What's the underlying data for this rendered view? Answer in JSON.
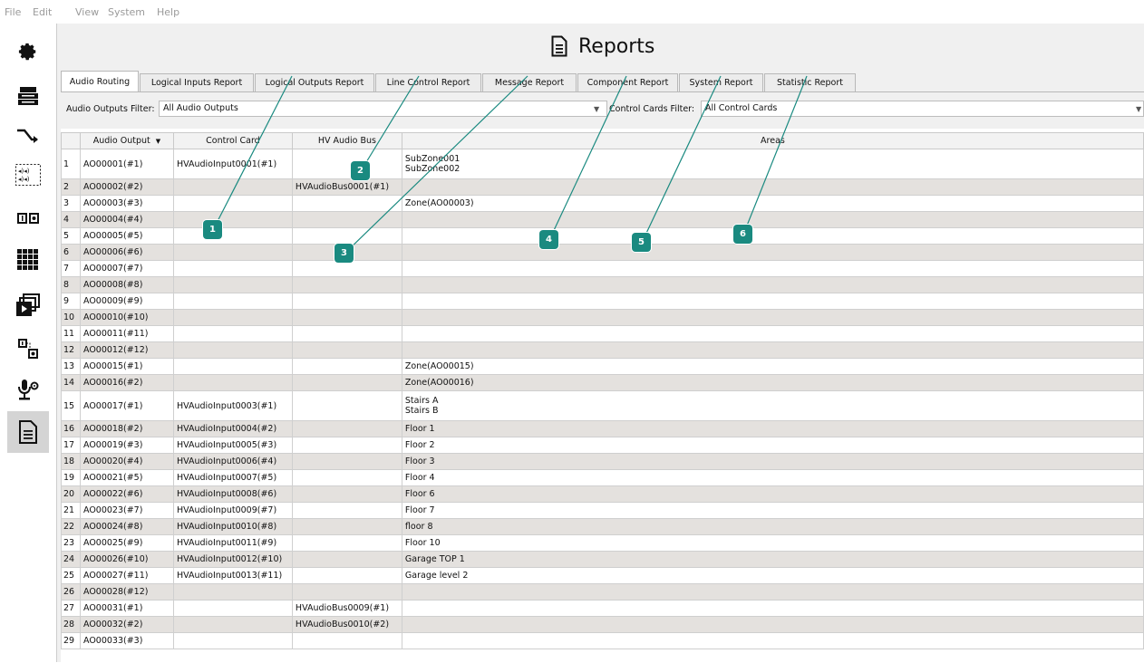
{
  "menu": [
    "File",
    "Edit",
    "View",
    "System",
    "Help"
  ],
  "sidebar": {
    "items": [
      {
        "icon": "gear-icon"
      },
      {
        "icon": "server-icon"
      },
      {
        "icon": "routing-arrow-icon"
      },
      {
        "icon": "speakers-icon"
      },
      {
        "icon": "io-modules-icon"
      },
      {
        "icon": "grid-icon"
      },
      {
        "icon": "media-player-icon"
      },
      {
        "icon": "connection-icon"
      },
      {
        "icon": "microphone-settings-icon"
      },
      {
        "icon": "document-icon",
        "active": true
      }
    ]
  },
  "header": {
    "title": "Reports",
    "icon": "document-icon"
  },
  "tabs": [
    {
      "label": "Audio Routing",
      "active": true
    },
    {
      "label": "Logical Inputs Report"
    },
    {
      "label": "Logical Outputs Report"
    },
    {
      "label": "Line Control Report"
    },
    {
      "label": "Message Report"
    },
    {
      "label": "Component Report"
    },
    {
      "label": "System Report"
    },
    {
      "label": "Statistic Report"
    }
  ],
  "filters": {
    "audio_outputs_label": "Audio Outputs Filter:",
    "audio_outputs_value": "All Audio Outputs",
    "control_cards_label": "Control Cards Filter:",
    "control_cards_value": "All Control Cards"
  },
  "table": {
    "columns": [
      "Audio Output",
      "Control Card",
      "HV Audio Bus",
      "Areas"
    ],
    "sort_indicator": "▼",
    "rows": [
      {
        "n": "1",
        "output": "AO00001(#1)",
        "card": "HVAudioInput0001(#1)",
        "bus": "",
        "areas": [
          "SubZone001",
          "SubZone002"
        ]
      },
      {
        "n": "2",
        "output": "AO00002(#2)",
        "card": "",
        "bus": "HVAudioBus0001(#1)",
        "areas": []
      },
      {
        "n": "3",
        "output": "AO00003(#3)",
        "card": "",
        "bus": "",
        "areas": [
          "Zone(AO00003)"
        ]
      },
      {
        "n": "4",
        "output": "AO00004(#4)",
        "card": "",
        "bus": "",
        "areas": []
      },
      {
        "n": "5",
        "output": "AO00005(#5)",
        "card": "",
        "bus": "",
        "areas": []
      },
      {
        "n": "6",
        "output": "AO00006(#6)",
        "card": "",
        "bus": "",
        "areas": []
      },
      {
        "n": "7",
        "output": "AO00007(#7)",
        "card": "",
        "bus": "",
        "areas": []
      },
      {
        "n": "8",
        "output": "AO00008(#8)",
        "card": "",
        "bus": "",
        "areas": []
      },
      {
        "n": "9",
        "output": "AO00009(#9)",
        "card": "",
        "bus": "",
        "areas": []
      },
      {
        "n": "10",
        "output": "AO00010(#10)",
        "card": "",
        "bus": "",
        "areas": []
      },
      {
        "n": "11",
        "output": "AO00011(#11)",
        "card": "",
        "bus": "",
        "areas": []
      },
      {
        "n": "12",
        "output": "AO00012(#12)",
        "card": "",
        "bus": "",
        "areas": []
      },
      {
        "n": "13",
        "output": "AO00015(#1)",
        "card": "",
        "bus": "",
        "areas": [
          "Zone(AO00015)"
        ]
      },
      {
        "n": "14",
        "output": "AO00016(#2)",
        "card": "",
        "bus": "",
        "areas": [
          "Zone(AO00016)"
        ]
      },
      {
        "n": "15",
        "output": "AO00017(#1)",
        "card": "HVAudioInput0003(#1)",
        "bus": "",
        "areas": [
          "Stairs A",
          "Stairs B"
        ]
      },
      {
        "n": "16",
        "output": "AO00018(#2)",
        "card": "HVAudioInput0004(#2)",
        "bus": "",
        "areas": [
          "Floor 1"
        ]
      },
      {
        "n": "17",
        "output": "AO00019(#3)",
        "card": "HVAudioInput0005(#3)",
        "bus": "",
        "areas": [
          "Floor 2"
        ]
      },
      {
        "n": "18",
        "output": "AO00020(#4)",
        "card": "HVAudioInput0006(#4)",
        "bus": "",
        "areas": [
          "Floor 3"
        ]
      },
      {
        "n": "19",
        "output": "AO00021(#5)",
        "card": "HVAudioInput0007(#5)",
        "bus": "",
        "areas": [
          "Floor 4"
        ]
      },
      {
        "n": "20",
        "output": "AO00022(#6)",
        "card": "HVAudioInput0008(#6)",
        "bus": "",
        "areas": [
          "Floor 6"
        ]
      },
      {
        "n": "21",
        "output": "AO00023(#7)",
        "card": "HVAudioInput0009(#7)",
        "bus": "",
        "areas": [
          "Floor 7"
        ]
      },
      {
        "n": "22",
        "output": "AO00024(#8)",
        "card": "HVAudioInput0010(#8)",
        "bus": "",
        "areas": [
          "floor 8"
        ]
      },
      {
        "n": "23",
        "output": "AO00025(#9)",
        "card": "HVAudioInput0011(#9)",
        "bus": "",
        "areas": [
          "Floor 10"
        ]
      },
      {
        "n": "24",
        "output": "AO00026(#10)",
        "card": "HVAudioInput0012(#10)",
        "bus": "",
        "areas": [
          "Garage TOP 1"
        ]
      },
      {
        "n": "25",
        "output": "AO00027(#11)",
        "card": "HVAudioInput0013(#11)",
        "bus": "",
        "areas": [
          "Garage level 2"
        ]
      },
      {
        "n": "26",
        "output": "AO00028(#12)",
        "card": "",
        "bus": "",
        "areas": []
      },
      {
        "n": "27",
        "output": "AO00031(#1)",
        "card": "",
        "bus": "HVAudioBus0009(#1)",
        "areas": []
      },
      {
        "n": "28",
        "output": "AO00032(#2)",
        "card": "",
        "bus": "HVAudioBus0010(#2)",
        "areas": []
      },
      {
        "n": "29",
        "output": "AO00033(#3)",
        "card": "",
        "bus": "",
        "areas": []
      }
    ]
  },
  "callouts": [
    {
      "label": "1"
    },
    {
      "label": "2"
    },
    {
      "label": "3"
    },
    {
      "label": "4"
    },
    {
      "label": "5"
    },
    {
      "label": "6"
    }
  ],
  "colors": {
    "callout": "#1a8a80",
    "alt_row": "#e4e1de"
  }
}
